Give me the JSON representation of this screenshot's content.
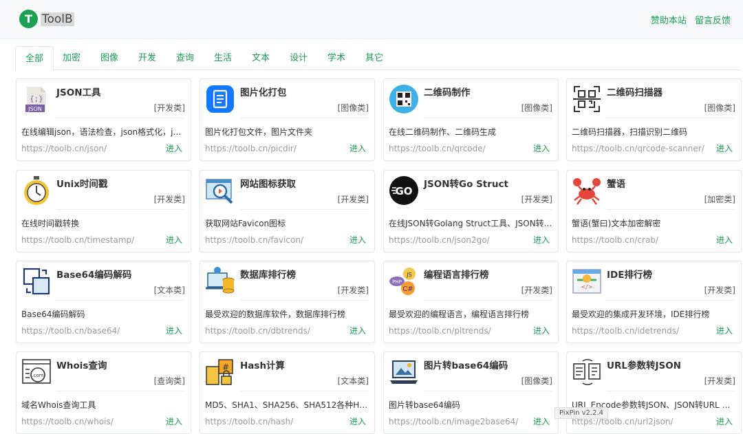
{
  "header": {
    "logo_letter": "T",
    "logo_text": "ToolB",
    "links": [
      "赞助本站",
      "留言反馈"
    ]
  },
  "tabs": [
    "全部",
    "加密",
    "图像",
    "开发",
    "查询",
    "生活",
    "文本",
    "设计",
    "学术",
    "其它"
  ],
  "enter_label": "进入",
  "cards": [
    {
      "title": "JSON工具",
      "cat": "[开发类]",
      "desc": "在线编辑json，语法检查，json格式化，js...",
      "url": "https://toolb.cn/json/",
      "icon": "json-file-icon"
    },
    {
      "title": "图片化打包",
      "cat": "[图像类]",
      "desc": "图片化打包文件，图片文件夹",
      "url": "https://toolb.cn/picdir/",
      "icon": "document-app-icon"
    },
    {
      "title": "二维码制作",
      "cat": "[图像类]",
      "desc": "在线二维码制作、二维码生成",
      "url": "https://toolb.cn/qrcode/",
      "icon": "qrcode-icon"
    },
    {
      "title": "二维码扫描器",
      "cat": "[图像类]",
      "desc": "二维码扫描器，扫描识别二维码",
      "url": "https://toolb.cn/qrcode-scanner/",
      "icon": "qr-scanner-icon"
    },
    {
      "title": "Unix时间戳",
      "cat": "[开发类]",
      "desc": "在线时间戳转换",
      "url": "https://toolb.cn/timestamp/",
      "icon": "stopwatch-icon"
    },
    {
      "title": "网站图标获取",
      "cat": "[开发类]",
      "desc": "获取网站Favicon图标",
      "url": "https://toolb.cn/favicon/",
      "icon": "magnifier-browser-icon"
    },
    {
      "title": "JSON转Go Struct",
      "cat": "[开发类]",
      "desc": "在线JSON转Golang Struct工具、JSON转...",
      "url": "https://toolb.cn/json2go/",
      "icon": "go-logo-icon"
    },
    {
      "title": "蟹语",
      "cat": "[加密类]",
      "desc": "蟹语(蟹曰)文本加密解密",
      "url": "https://toolb.cn/crab/",
      "icon": "crab-icon"
    },
    {
      "title": "Base64编码解码",
      "cat": "[文本类]",
      "desc": "Base64编码解码",
      "url": "https://toolb.cn/base64/",
      "icon": "convert-squares-icon"
    },
    {
      "title": "数据库排行榜",
      "cat": "[开发类]",
      "desc": "最受欢迎的数据库软件，数据库排行榜",
      "url": "https://toolb.cn/dbtrends/",
      "icon": "database-laptop-icon"
    },
    {
      "title": "编程语言排行榜",
      "cat": "[开发类]",
      "desc": "最受欢迎的编程语言，编程语言排行榜",
      "url": "https://toolb.cn/pltrends/",
      "icon": "languages-icon"
    },
    {
      "title": "IDE排行榜",
      "cat": "[开发类]",
      "desc": "最受欢迎的集成开发环境，IDE排行榜",
      "url": "https://toolb.cn/idetrends/",
      "icon": "ide-window-icon"
    },
    {
      "title": "Whois查询",
      "cat": "[查询类]",
      "desc": "域名Whois查询工具",
      "url": "https://toolb.cn/whois/",
      "icon": "whois-com-icon"
    },
    {
      "title": "Hash计算",
      "cat": "[文本类]",
      "desc": "MD5、SHA1、SHA256、SHA512各种HA...",
      "url": "https://toolb.cn/hash/",
      "icon": "hash-lock-icon"
    },
    {
      "title": "图片转base64编码",
      "cat": "[图像类]",
      "desc": "图片转base64编码",
      "url": "https://toolb.cn/image2base64/",
      "icon": "image-laptop-icon"
    },
    {
      "title": "URL参数转JSON",
      "cat": "[开发类]",
      "desc": "URL Encode参数转JSON、JSON转URL En...",
      "url": "https://toolb.cn/url2json/",
      "icon": "url-json-icon"
    }
  ],
  "overlay": "PixPin v2.2.4"
}
